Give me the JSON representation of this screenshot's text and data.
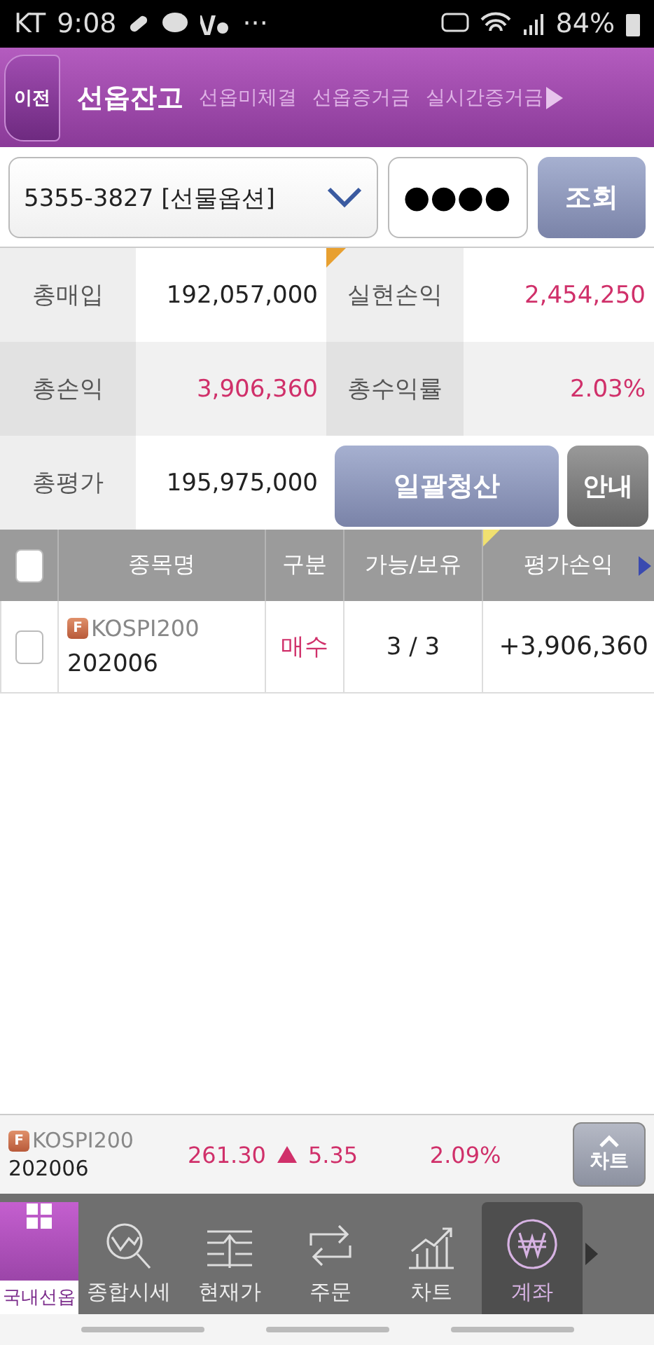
{
  "status_bar": {
    "carrier": "KT",
    "time": "9:08",
    "more": "···",
    "battery": "84%"
  },
  "top_nav": {
    "back": "이전",
    "tabs": [
      {
        "label": "선옵잔고",
        "selected": true
      },
      {
        "label": "선옵미체결",
        "selected": false
      },
      {
        "label": "선옵증거금",
        "selected": false
      },
      {
        "label": "실시간증거금",
        "selected": false
      }
    ]
  },
  "account": {
    "value": "5355-3827 [선물옵션]",
    "password": "●●●●",
    "query_button": "조회"
  },
  "summary": [
    {
      "label": "총매입",
      "value": "192,057,000",
      "positive": false
    },
    {
      "label": "실현손익",
      "value": "2,454,250",
      "positive": true
    },
    {
      "label": "총손익",
      "value": "3,906,360",
      "positive": true
    },
    {
      "label": "총수익률",
      "value": "2.03%",
      "positive": true
    },
    {
      "label": "총평가",
      "value": "195,975,000",
      "positive": false
    }
  ],
  "actions": {
    "liquidate": "일괄청산",
    "guide": "안내"
  },
  "table": {
    "select_all_checked": false,
    "columns": [
      "종목명",
      "구분",
      "가능/보유",
      "평가손익"
    ],
    "rows": [
      {
        "checked": false,
        "badge": "F",
        "name": "KOSPI200",
        "code": "202006",
        "side": "매수",
        "qty": "3 / 3",
        "pnl": "+3,906,360"
      }
    ]
  },
  "ticker": {
    "badge": "F",
    "name": "KOSPI200",
    "code": "202006",
    "price": "261.30",
    "change": "5.35",
    "rate": "2.09%",
    "chart_button": "차트"
  },
  "bottom_nav": [
    {
      "kind": "home",
      "label": "국내선옵",
      "selected": false
    },
    {
      "kind": "market",
      "label": "종합시세",
      "selected": false
    },
    {
      "kind": "price",
      "label": "현재가",
      "selected": false
    },
    {
      "kind": "order",
      "label": "주문",
      "selected": false
    },
    {
      "kind": "chart",
      "label": "차트",
      "selected": false
    },
    {
      "kind": "account",
      "label": "계좌",
      "selected": true
    }
  ]
}
